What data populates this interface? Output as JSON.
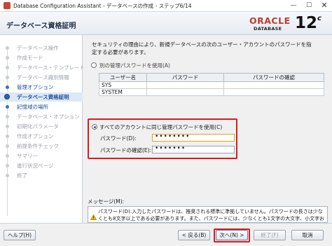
{
  "window": {
    "title": "Database Configuration Assistant - データベースの作成 - ステップ6/14",
    "minimize": "—",
    "maximize": "☐",
    "close": "✕"
  },
  "header": {
    "page_title": "データベース資格証明",
    "logo_brand": "ORACLE",
    "logo_product": "DATABASE",
    "logo_version": "12",
    "logo_version_suffix": "c"
  },
  "steps": [
    {
      "label": "データベース操作",
      "state": "done"
    },
    {
      "label": "作成モード",
      "state": "done"
    },
    {
      "label": "データベース・テンプレート",
      "state": "done"
    },
    {
      "label": "データベース識別情報",
      "state": "done"
    },
    {
      "label": "管理オプション",
      "state": "link"
    },
    {
      "label": "データベース資格証明",
      "state": "active"
    },
    {
      "label": "記憶域の場所",
      "state": "link"
    },
    {
      "label": "データベース・オプション",
      "state": "todo"
    },
    {
      "label": "初期化パラメータ",
      "state": "todo"
    },
    {
      "label": "作成オプション",
      "state": "todo"
    },
    {
      "label": "前提条件チェック",
      "state": "todo"
    },
    {
      "label": "サマリー",
      "state": "todo"
    },
    {
      "label": "進行状況ページ",
      "state": "todo"
    },
    {
      "label": "終了",
      "state": "todo"
    }
  ],
  "content": {
    "info_text": "セキュリティの理由により、新規データベースの次のユーザー・アカウントのパスワードを指定する必要があります。",
    "option_separate": "別の管理パスワードを使用(A)",
    "table": {
      "headers": [
        "ユーザー名",
        "パスワード",
        "パスワードの確認"
      ],
      "rows": [
        {
          "user": "SYS",
          "password": "",
          "confirm": ""
        },
        {
          "user": "SYSTEM",
          "password": "",
          "confirm": ""
        }
      ]
    },
    "option_same": "すべてのアカウントに同じ管理パスワードを使用(C)",
    "password_label": "パスワード(D):",
    "password_value": "••••••••",
    "confirm_label": "パスワードの確認(E):",
    "confirm_value": "•••••••",
    "message_label": "メッセージ(M):",
    "message_text": "パスワード(D):入力したパスワードは、推奨される標準に準拠していません。パスワードの長さは少なくとも8文字以上である必要があります。また、パスワードには、少なくとも1文字の大文字、小文字および数字を含める必要があります。"
  },
  "footer": {
    "help": "ヘルプ(H)",
    "back": "< 戻る(B)",
    "next": "次へ(N) >",
    "finish": "終了(F)",
    "cancel": "取消"
  },
  "colors": {
    "highlight": "#e01a1a",
    "oracle_red": "#c0392b",
    "accent_blue": "#1f4f9a"
  }
}
